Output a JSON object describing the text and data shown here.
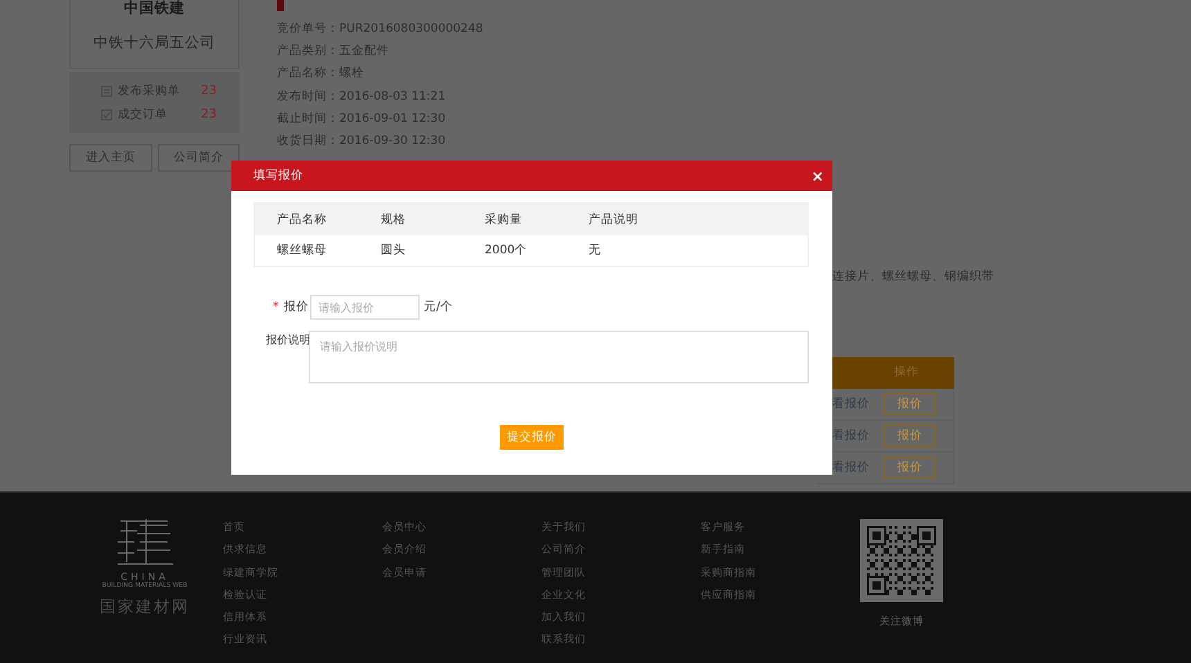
{
  "sidebar": {
    "company_group": "中国铁建",
    "company_name": "中铁十六局五公司",
    "stats": [
      {
        "kind": "list",
        "label": "发布采购单",
        "count": "23"
      },
      {
        "kind": "check",
        "label": "成交订单",
        "count": "23"
      }
    ],
    "buttons": [
      "进入主页",
      "公司简介"
    ]
  },
  "details": {
    "fields": [
      "竞价单号：PUR2016080300000248",
      "产品类别：五金配件",
      "产品名称：螺栓",
      "发布时间：2016-08-03 11:21",
      "截止时间：2016-09-01 12:30",
      "收货日期：2016-09-30 12:30"
    ],
    "description_tail": "连接片、螺丝螺母、钢编织带"
  },
  "quote_table": {
    "columns": [
      "操作"
    ],
    "rows": [
      {
        "link": "看报价",
        "button": "报价"
      },
      {
        "link": "看报价",
        "button": "报价"
      },
      {
        "link": "看报价",
        "button": "报价"
      }
    ]
  },
  "modal": {
    "title": "填写报价",
    "close": "×",
    "table": {
      "columns": [
        "产品名称",
        "规格",
        "采购量",
        "产品说明"
      ],
      "rows": [
        [
          "螺丝螺母",
          "圆头",
          "2000个",
          "无"
        ]
      ]
    },
    "price": {
      "required_mark": "*",
      "label": "报价",
      "placeholder": "请输入报价",
      "unit": "元/个"
    },
    "note": {
      "label": "报价说明",
      "placeholder": "请输入报价说明"
    },
    "submit": "提交报价"
  },
  "footer": {
    "logo": {
      "line1": "CHINA",
      "line2": "BUILDING MATERIALS WEB",
      "name": "国家建材网"
    },
    "columns": [
      [
        "首页",
        "供求信息",
        "绿建商学院",
        "检验认证",
        "信用体系",
        "行业资讯"
      ],
      [
        "会员中心",
        "会员介绍",
        "会员申请"
      ],
      [
        "关于我们",
        "公司简介",
        "管理团队",
        "企业文化",
        "加入我们",
        "联系我们"
      ],
      [
        "客户服务",
        "新手指南",
        "采购商指南",
        "供应商指南"
      ]
    ],
    "qr_caption": "关注微博"
  }
}
